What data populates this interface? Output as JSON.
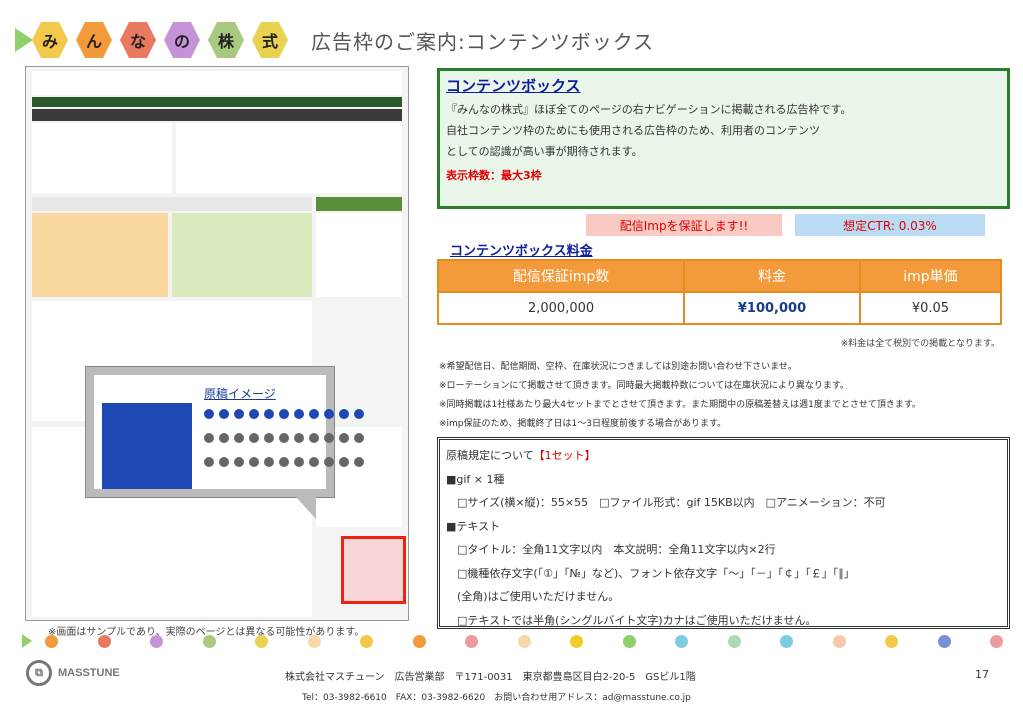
{
  "header": {
    "logo_chars": [
      {
        "char": "み",
        "color": "#f3c84b"
      },
      {
        "char": "ん",
        "color": "#f39a3a"
      },
      {
        "char": "な",
        "color": "#e9795f"
      },
      {
        "char": "の",
        "color": "#c793d8"
      },
      {
        "char": "株",
        "color": "#a8c97f"
      },
      {
        "char": "式",
        "color": "#e8d24f"
      }
    ],
    "title": "広告枠のご案内:コンテンツボックス"
  },
  "screenshot": {
    "popup_title": "原稿イメージ",
    "note": "※画面はサンプルであり、実際のページとは異なる可能性があります。"
  },
  "content_box": {
    "title": "コンテンツボックス",
    "lines": [
      "『みんなの株式』ほぼ全てのページの右ナビゲーションに掲載される広告枠です。",
      "自社コンテンツ枠のためにも使用される広告枠のため、利用者のコンテンツ",
      "としての認識が高い事が期待されます。"
    ],
    "count": "表示枠数：最大3枠"
  },
  "tags": {
    "imp": "配信Impを保証します!!",
    "ctr": "想定CTR: 0.03%"
  },
  "price": {
    "title": "コンテンツボックス料金",
    "headers": [
      "配信保証imp数",
      "料金",
      "imp単価"
    ],
    "row": [
      "2,000,000",
      "¥100,000",
      "¥0.05"
    ],
    "tax_note": "※料金は全て税別での掲載となります。"
  },
  "notes": [
    "※希望配信日、配信期間、空枠、在庫状況につきましては別途お問い合わせ下さいませ。",
    "※ローテーションにて掲載させて頂きます。同時最大掲載枠数については在庫状況により異なります。",
    "※同時掲載は1社様あたり最大4セットまでとさせて頂きます。また期間中の原稿差替えは週1度までとさせて頂きます。",
    "※imp保証のため、掲載終了日は1～3日程度前後する場合があります。"
  ],
  "rules": {
    "heading": "原稿規定について",
    "heading_red": "【1セット】",
    "lines": [
      "■gif × 1種",
      "　□サイズ(横×縦)：55×55　□ファイル形式：gif 15KB以内　□アニメーション：不可",
      "■テキスト",
      "　□タイトル：全角11文字以内　本文説明：全角11文字以内×2行",
      "　□機種依存文字(「①」「№」など)、フォント依存文字「～」「－」「￠」「￡」「∥」",
      "　(全角)はご使用いただけません。",
      "　□テキストでは半角(シングルバイト文字)カナはご使用いただけません。"
    ]
  },
  "footer": {
    "brand": "MASSTUNE",
    "address": "株式会社マスチューン　広告営業部　〒171-0031　東京都豊島区目白2-20-5　GSビル1階",
    "contact": "Tel：03-3982-6610　FAX：03-3982-6620　お問い合わせ用アドレス：ad@masstune.co.jp",
    "page": "17"
  },
  "dot_colors": [
    "#f39a3a",
    "#e9795f",
    "#c793d8",
    "#a8c97f",
    "#e8d24f",
    "#f9d8a8",
    "#f3c84b",
    "#f39a3a",
    "#ef9aa0",
    "#f5d9a8",
    "#f4cc2a",
    "#8fd06a",
    "#7dcde0",
    "#aadcb4",
    "#7dcde0",
    "#f7c9a8",
    "#f3c84b",
    "#7b8fd8",
    "#ee9b9b"
  ]
}
